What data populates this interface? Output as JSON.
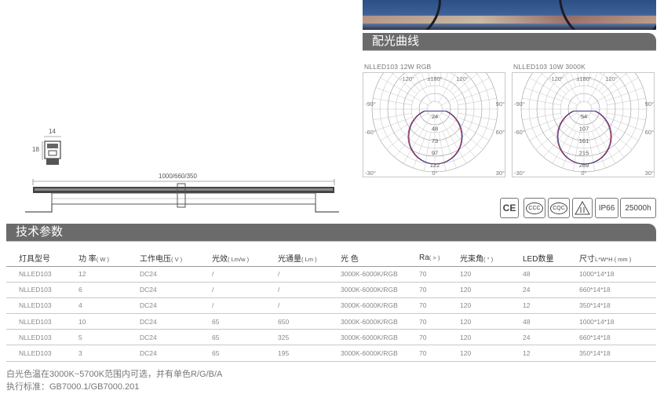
{
  "sections": {
    "curve_title": "配光曲线",
    "param_title": "技术参数"
  },
  "polar_charts": [
    {
      "label": "NLLED103 12W RGB",
      "radial_ticks": [
        "24",
        "48",
        "73",
        "97",
        "122"
      ],
      "angles": {
        "top_left": "-120°",
        "top": "±180°",
        "top_right": "120°",
        "mid_left": "-90°",
        "mid_right": "90°",
        "low_left": "-60°",
        "low_right": "60°",
        "bottom_left": "-30°",
        "bottom": "0°",
        "bottom_right": "30°"
      }
    },
    {
      "label": "NLLED103 10W 3000K",
      "radial_ticks": [
        "54",
        "107",
        "161",
        "215",
        "269"
      ],
      "angles": {
        "top_left": "-120°",
        "top": "±180°",
        "top_right": "120°",
        "mid_left": "-90°",
        "mid_right": "90°",
        "low_left": "-60°",
        "low_right": "60°",
        "bottom_left": "-30°",
        "bottom": "0°",
        "bottom_right": "30°"
      }
    }
  ],
  "drawing": {
    "width_dim": "14",
    "height_dim": "18",
    "length_dim": "1000/660/350"
  },
  "certifications": {
    "ce": "CE",
    "ccc": "CCC",
    "cqc": "CQC",
    "ip": "IP66",
    "life": "25000h"
  },
  "table": {
    "headers": [
      {
        "label": "灯具型号",
        "unit": ""
      },
      {
        "label": "功 率",
        "unit": "( W )"
      },
      {
        "label": "工作电压",
        "unit": "( V )"
      },
      {
        "label": "光效",
        "unit": "( Lm/w )"
      },
      {
        "label": "光通量",
        "unit": "( Lm )"
      },
      {
        "label": "光 色",
        "unit": ""
      },
      {
        "label": "Ra",
        "unit": "( > )"
      },
      {
        "label": "光束角",
        "unit": "( ° )"
      },
      {
        "label": "LED数量",
        "unit": ""
      },
      {
        "label": "尺寸",
        "unit": "L*W*H ( mm )"
      }
    ],
    "rows": [
      [
        "NLLED103",
        "12",
        "DC24",
        "/",
        "/",
        "3000K-6000K/RGB",
        "70",
        "120",
        "48",
        "1000*14*18"
      ],
      [
        "NLLED103",
        "6",
        "DC24",
        "/",
        "/",
        "3000K-6000K/RGB",
        "70",
        "120",
        "24",
        "660*14*18"
      ],
      [
        "NLLED103",
        "4",
        "DC24",
        "/",
        "/",
        "3000K-6000K/RGB",
        "70",
        "120",
        "12",
        "350*14*18"
      ],
      [
        "NLLED103",
        "10",
        "DC24",
        "65",
        "650",
        "3000K-6000K/RGB",
        "70",
        "120",
        "48",
        "1000*14*18"
      ],
      [
        "NLLED103",
        "5",
        "DC24",
        "65",
        "325",
        "3000K-6000K/RGB",
        "70",
        "120",
        "24",
        "660*14*18"
      ],
      [
        "NLLED103",
        "3",
        "DC24",
        "65",
        "195",
        "3000K-6000K/RGB",
        "70",
        "120",
        "12",
        "350*14*18"
      ]
    ]
  },
  "notes": {
    "line1": "白光色温在3000K~5700K范围内可选，并有单色R/G/B/A",
    "line2": "执行标准：GB7000.1/GB7000.201"
  }
}
